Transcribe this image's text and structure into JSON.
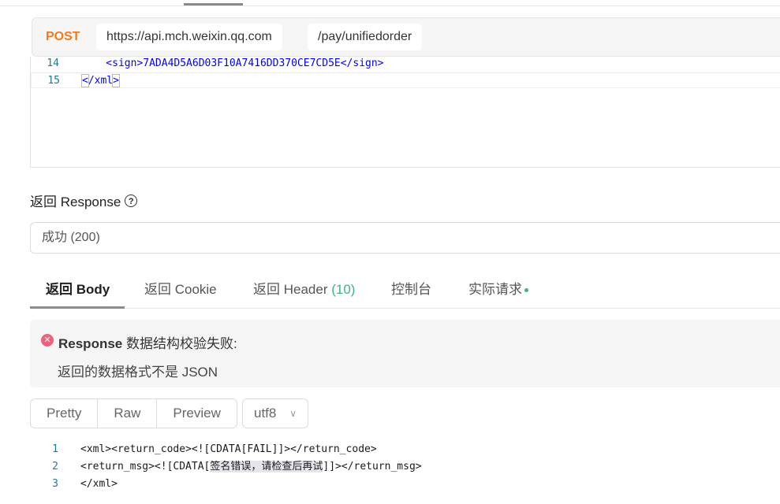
{
  "request": {
    "method": "POST",
    "base_url": "https://api.mch.weixin.qq.com",
    "path": "/pay/unifiedorder"
  },
  "request_editor": {
    "lines": [
      {
        "no": "14",
        "text": "    <sign>7ADA4D5A6D03F10A7416DD370CE7CD5E</sign>"
      },
      {
        "no": "15",
        "text": "</xml>"
      }
    ]
  },
  "response": {
    "title": "返回 Response",
    "help_icon": "question-circle-icon",
    "status": "成功 (200)",
    "tabs": {
      "body": "返回 Body",
      "cookie": "返回 Cookie",
      "header": "返回 Header",
      "header_count": "(10)",
      "console": "控制台",
      "actual_request": "实际请求"
    },
    "error": {
      "icon": "error-x-icon",
      "title_bold": "Response",
      "title_rest": " 数据结构校验失败:",
      "detail": "返回的数据格式不是 JSON"
    },
    "view_modes": {
      "pretty": "Pretty",
      "raw": "Raw",
      "preview": "Preview"
    },
    "encoding": "utf8",
    "body_lines": [
      {
        "no": "1",
        "text": "<xml><return_code><![CDATA[FAIL]]></return_code>"
      },
      {
        "no": "2",
        "pre": "<return_msg><![CDATA[",
        "hl": "签名错误，请检查后再试",
        "post": "]]></return_msg>"
      },
      {
        "no": "3",
        "text": "</xml>"
      }
    ]
  },
  "colors": {
    "method": "#f07b1f",
    "success_count": "#3fb27f",
    "error_icon": "#f0607a"
  }
}
